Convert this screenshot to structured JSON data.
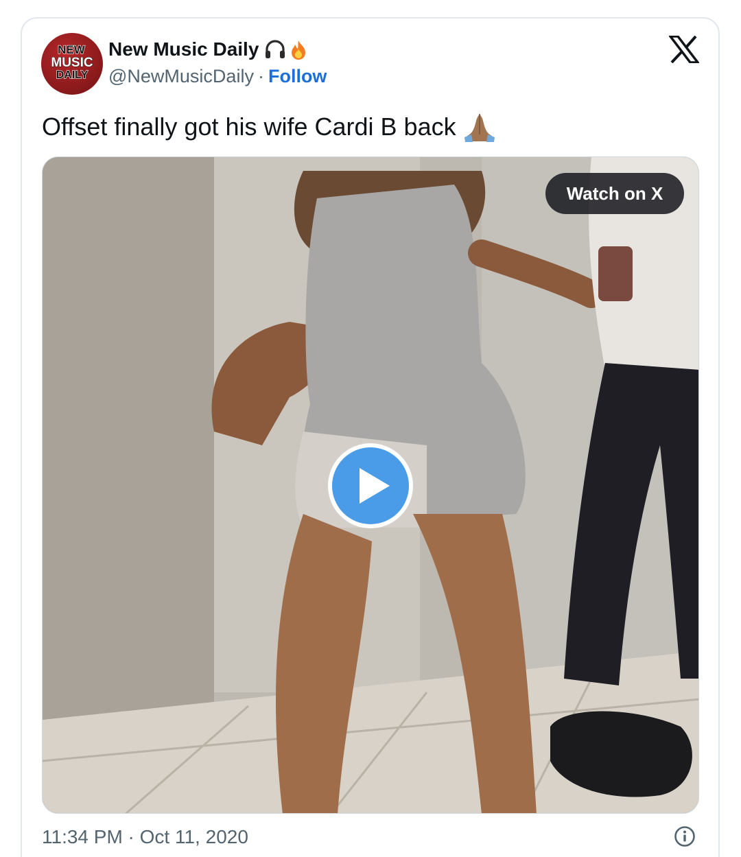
{
  "author": {
    "name": "New Music Daily",
    "name_emojis": [
      "headphones-icon",
      "fire-icon"
    ],
    "handle": "@NewMusicDaily",
    "separator": "·",
    "follow_label": "Follow",
    "avatar_text": [
      "NEW",
      "MUSIC",
      "DAILY"
    ]
  },
  "tweet": {
    "text": "Offset finally got his wife Cardi B back",
    "text_emoji": "folded-hands-icon"
  },
  "media": {
    "watch_label": "Watch on X",
    "play_icon": "play-icon"
  },
  "footer": {
    "timestamp": "11:34 PM · Oct 11, 2020",
    "info_icon": "info-icon"
  },
  "brand": {
    "platform_icon": "x-logo-icon"
  },
  "colors": {
    "follow": "#1d6fd8",
    "play_button": "#4a9be8",
    "avatar_red": "#9b2022",
    "secondary_text": "#536471"
  }
}
